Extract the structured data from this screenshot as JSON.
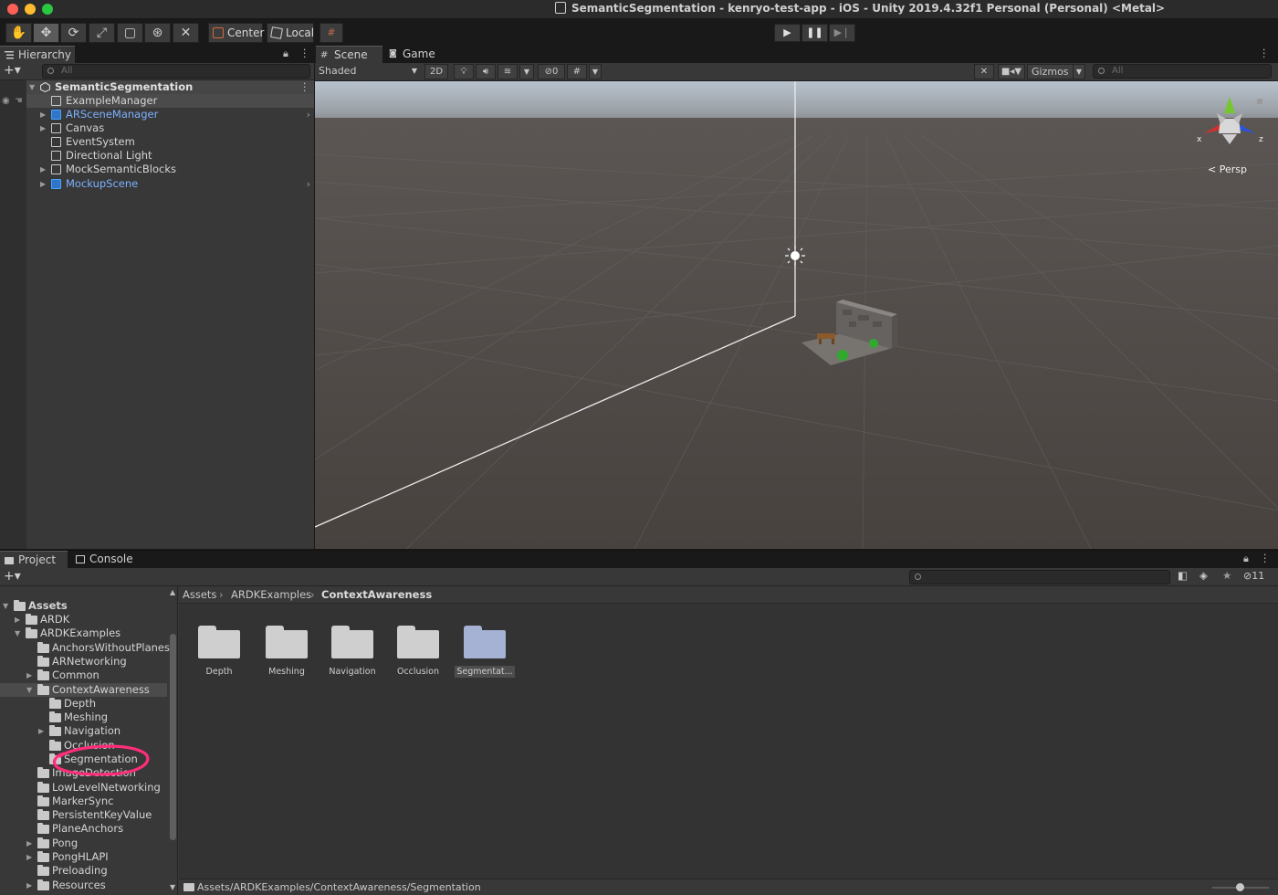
{
  "window": {
    "title": "SemanticSegmentation - kenryo-test-app - iOS - Unity 2019.4.32f1 Personal (Personal) <Metal>"
  },
  "toolbar": {
    "pivot_label": "Center",
    "space_label": "Local"
  },
  "hierarchy": {
    "tab_label": "Hierarchy",
    "search_placeholder": "All",
    "scene_name": "SemanticSegmentation",
    "items": [
      {
        "label": "ExampleManager"
      },
      {
        "label": "ARSceneManager"
      },
      {
        "label": "Canvas"
      },
      {
        "label": "EventSystem"
      },
      {
        "label": "Directional Light"
      },
      {
        "label": "MockSemanticBlocks"
      },
      {
        "label": "MockupScene"
      }
    ]
  },
  "scene": {
    "tab_scene": "Scene",
    "tab_game": "Game",
    "shading_mode": "Shaded",
    "mode_2d": "2D",
    "hidden_count": "0",
    "gizmos_label": "Gizmos",
    "search_placeholder": "All",
    "gizmo_x": "x",
    "gizmo_z": "z",
    "projection_label": "Persp"
  },
  "project": {
    "tab_project": "Project",
    "tab_console": "Console",
    "hidden_count": "11",
    "tree": [
      {
        "label": "Assets"
      },
      {
        "label": "ARDK"
      },
      {
        "label": "ARDKExamples"
      },
      {
        "label": "AnchorsWithoutPlanes"
      },
      {
        "label": "ARNetworking"
      },
      {
        "label": "Common"
      },
      {
        "label": "ContextAwareness"
      },
      {
        "label": "Depth"
      },
      {
        "label": "Meshing"
      },
      {
        "label": "Navigation"
      },
      {
        "label": "Occlusion"
      },
      {
        "label": "Segmentation"
      },
      {
        "label": "ImageDetection"
      },
      {
        "label": "LowLevelNetworking"
      },
      {
        "label": "MarkerSync"
      },
      {
        "label": "PersistentKeyValue"
      },
      {
        "label": "PlaneAnchors"
      },
      {
        "label": "Pong"
      },
      {
        "label": "PongHLAPI"
      },
      {
        "label": "Preloading"
      },
      {
        "label": "Resources"
      }
    ],
    "breadcrumb": [
      "Assets",
      "ARDKExamples",
      "ContextAwareness"
    ],
    "folders": [
      {
        "label": "Depth"
      },
      {
        "label": "Meshing"
      },
      {
        "label": "Navigation"
      },
      {
        "label": "Occlusion"
      },
      {
        "label": "Segmentat..."
      }
    ],
    "status_path": "Assets/ARDKExamples/ContextAwareness/Segmentation"
  },
  "colors": {
    "annotation_circle": "#ff2d7a",
    "prefab_blue": "#7cb1ff",
    "selected_folder": "#a6b2d4"
  }
}
